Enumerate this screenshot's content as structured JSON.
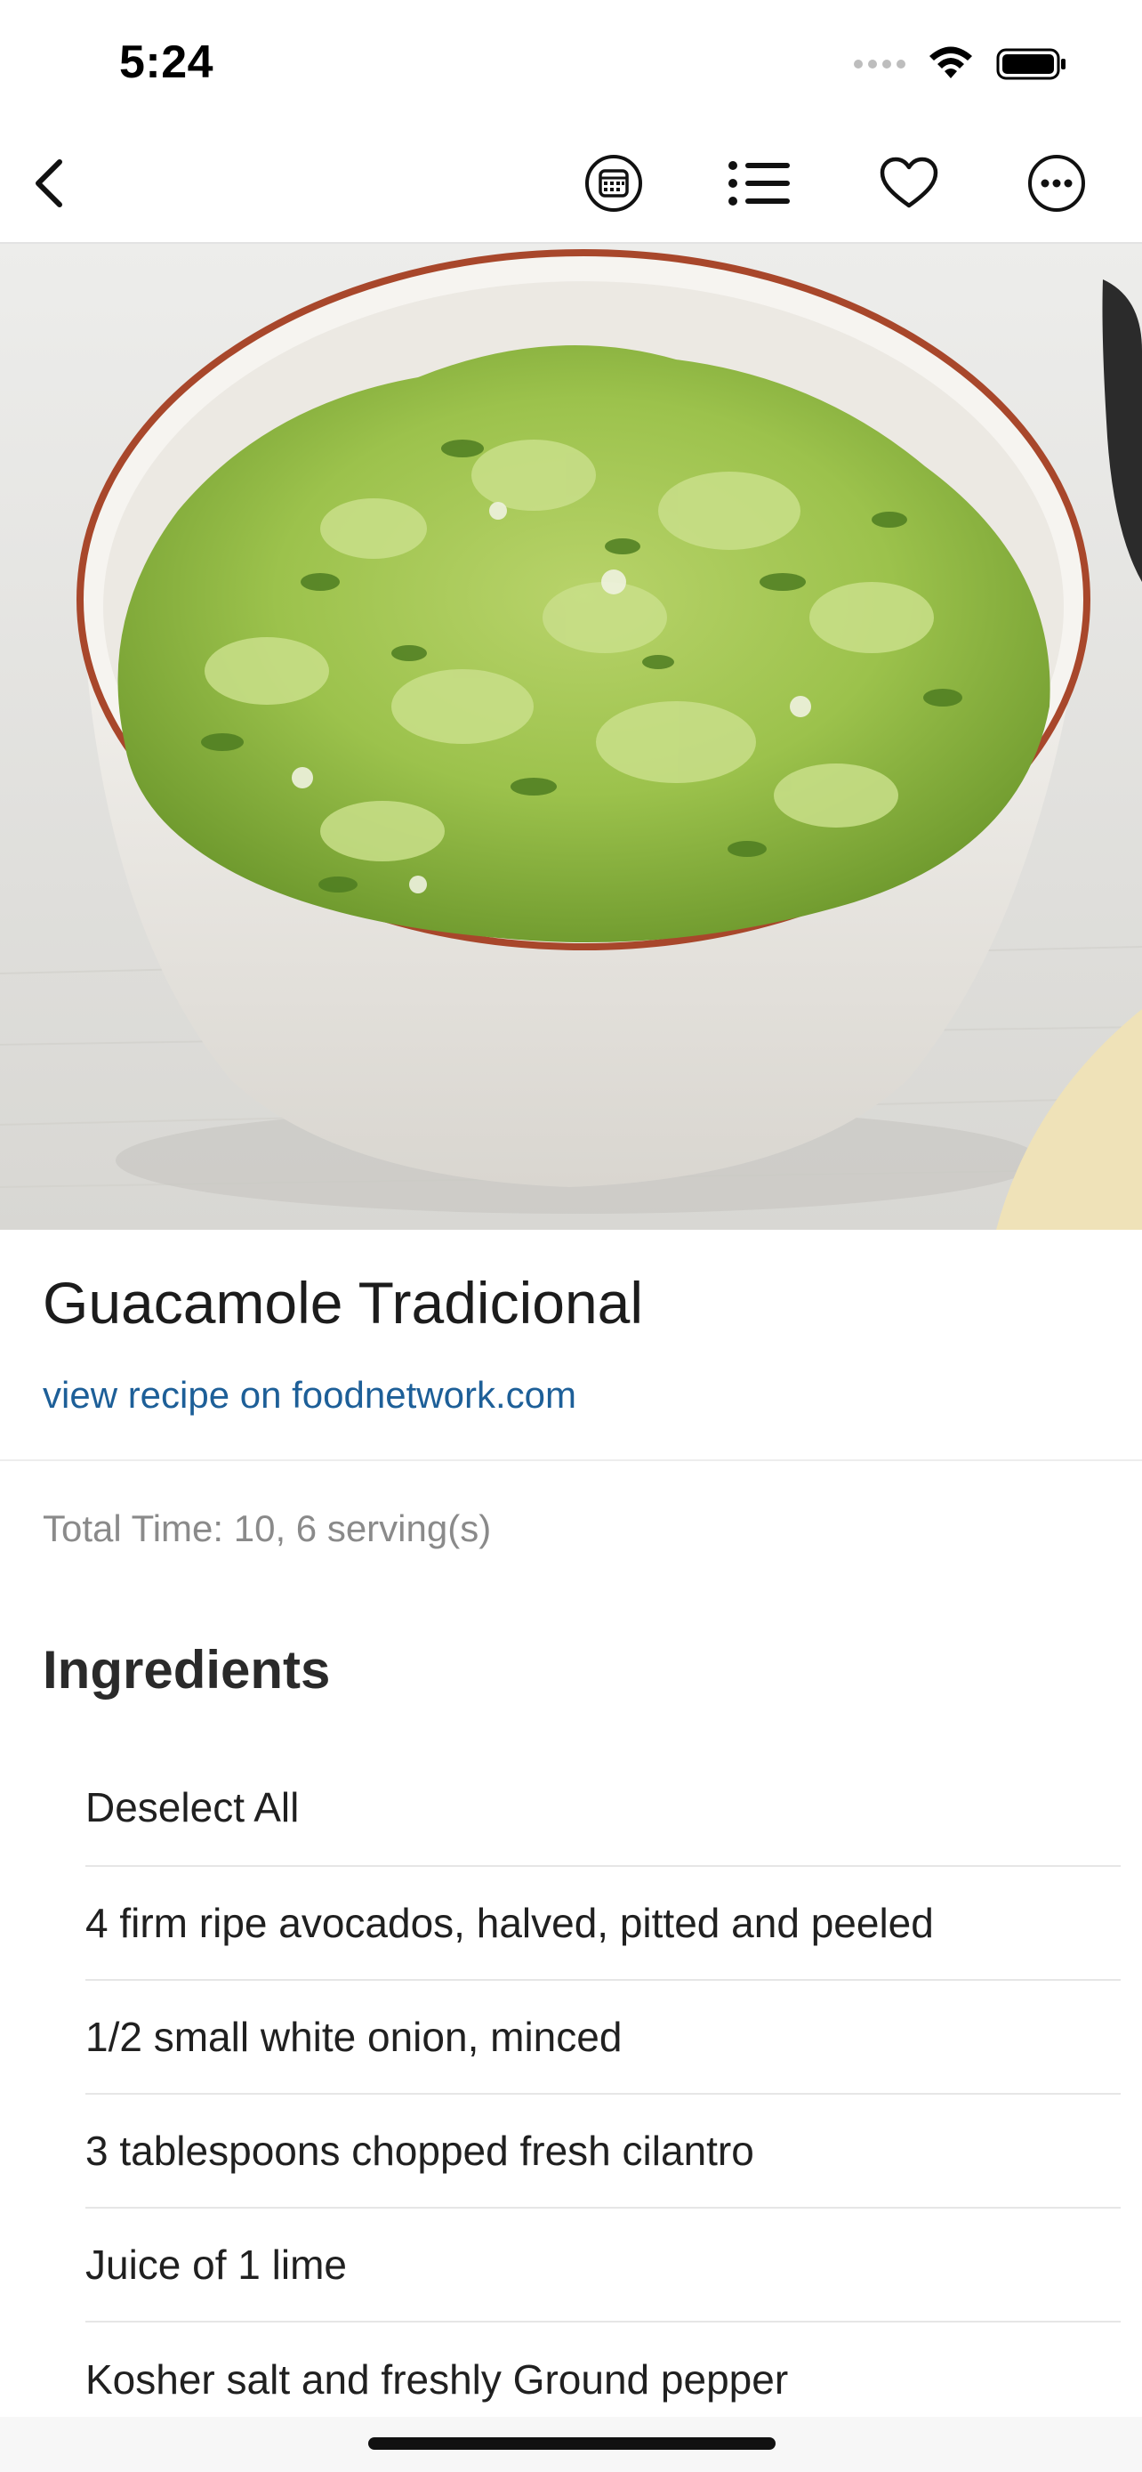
{
  "status_bar": {
    "time": "5:24"
  },
  "nav": {
    "back_icon": "chevron-left-icon",
    "actions": [
      "calendar-icon",
      "list-icon",
      "heart-icon",
      "more-icon"
    ]
  },
  "hero": {
    "alt": "Bowl of guacamole"
  },
  "recipe": {
    "title": "Guacamole Tradicional",
    "source_link": "view recipe on foodnetwork.com",
    "meta": "Total Time: 10, 6 serving(s)"
  },
  "ingredients": {
    "heading": "Ingredients",
    "items": [
      "Deselect All",
      "4 firm ripe avocados, halved, pitted and peeled",
      "1/2 small white onion, minced",
      "3 tablespoons chopped fresh cilantro",
      "Juice of 1 lime",
      "Kosher salt and freshly Ground pepper"
    ]
  },
  "colors": {
    "link": "#1d5f98",
    "divider": "#e6e6e6",
    "meta_text": "#8a8a8a"
  }
}
